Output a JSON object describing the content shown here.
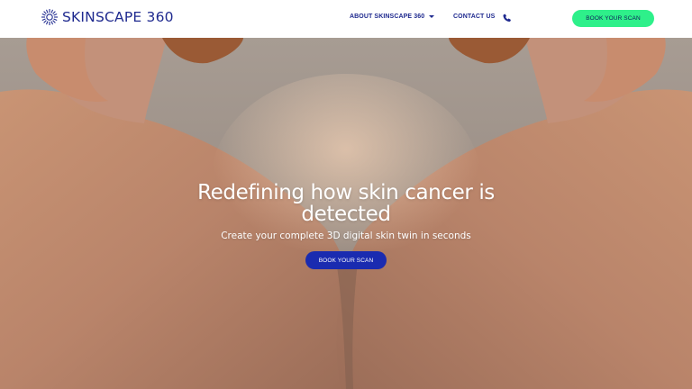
{
  "brand": {
    "name": "SKINSCAPE 360",
    "color": "#1f2a8f"
  },
  "nav": {
    "about_label": "ABOUT SKINSCAPE 360",
    "contact_label": "CONTACT US",
    "book_label": "BOOK YOUR SCAN"
  },
  "hero": {
    "title_line1": "Redefining how skin cancer is",
    "title_line2": "detected",
    "subtitle": "Create your complete 3D digital skin twin in seconds",
    "cta_label": "BOOK YOUR SCAN"
  },
  "colors": {
    "accent_green": "#2ef08a",
    "accent_blue": "#1a2bb0"
  },
  "icons": [
    "logo-mark-icon",
    "chevron-down-icon",
    "phone-icon"
  ]
}
